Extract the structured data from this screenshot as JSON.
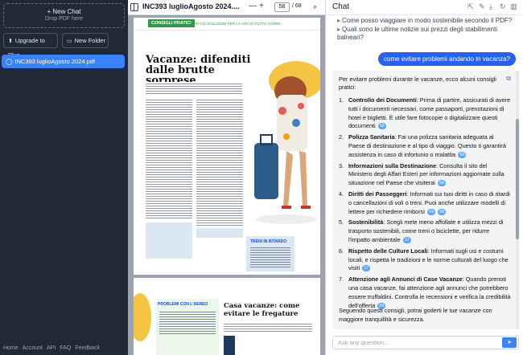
{
  "sidebar": {
    "new_chat": "+ New Chat",
    "drop_hint": "Drop PDF here",
    "upgrade": "Upgrade to Plus",
    "new_folder": "New Folder",
    "file": "INC393 luglioAgosto 2024.pdf",
    "footer": [
      "Home",
      "Account",
      "API",
      "FAQ",
      "Feedback"
    ]
  },
  "pdf": {
    "title": "INC393 luglioAgosto 2024....",
    "zoom_out": "—",
    "zoom_in": "+",
    "page": "58",
    "total": "/ 68",
    "badge": "CONSIGLI PRATICI",
    "subtitle": "DIRITTI E SOLUZIONI PER LA VITA DI TUTTI I GIORNI",
    "headline": "Vacanze: difenditi dalle brutte sorprese",
    "box_title": "TRENI IN RITARDO",
    "p2_left": "PROBLEMI CON L'AEREO",
    "p2_headline": "Casa vacanze: come evitare le fregature"
  },
  "chat": {
    "title": "Chat",
    "suggestions": [
      "Come posso viaggiare in modo sostenibile secondo il PDF?",
      "Quali sono le ultime notizie sui prezzi degli stabilimenti balneari?"
    ],
    "user_question": "come evitare problemi andando in vacanza?",
    "intro": "Per evitare problemi durante le vacanze, ecco alcuni consigli pratici:",
    "items": [
      {
        "n": "1.",
        "b": "Controllo dei Documenti",
        "t": ": Prima di partire, assicurati di avere tutti i documenti necessari, come passaporti, prenotazioni di hotel e biglietti. È utile fare fotocopie o digitalizzare questi documenti",
        "c": [
          "58"
        ]
      },
      {
        "n": "2.",
        "b": "Polizza Sanitaria",
        "t": ": Fai una polizza sanitaria adeguata al Paese di destinazione e al tipo di viaggio. Questo ti garantirà assistenza in caso di infortunio o malattia",
        "c": [
          "58"
        ]
      },
      {
        "n": "3.",
        "b": "Informazioni sulla Destinazione",
        "t": ": Consulta il sito del Ministero degli Affari Esteri per informazioni aggiornate sulla situazione nel Paese che visiterai",
        "c": [
          "58"
        ]
      },
      {
        "n": "4.",
        "b": "Diritti dei Passeggeri",
        "t": ": Informati sui tuoi diritti in caso di ritardi o cancellazioni di voli o treni. Puoi anche utilizzare modelli di lettere per richiedere rimborsi",
        "c": [
          "59",
          "58"
        ]
      },
      {
        "n": "5.",
        "b": "Sostenibilità",
        "t": ": Scegli mete meno affollate e utilizza mezzi di trasporto sostenibili, come treni o biciclette, per ridurre l'impatto ambientale",
        "c": [
          "17"
        ]
      },
      {
        "n": "6.",
        "b": "Rispetto delle Culture Locali",
        "t": ": Informati sugli usi e costumi locali, e rispetta le tradizioni e le norme culturali del luogo che visiti",
        "c": [
          "17"
        ]
      },
      {
        "n": "7.",
        "b": "Attenzione agli Annunci di Case Vacanze",
        "t": ": Quando prenoti una casa vacanze, fai attenzione agli annunci che potrebbero essere truffaldini. Controlla le recensioni e verifica la credibilità dell'offerta",
        "c": [
          "59"
        ]
      }
    ],
    "conclusion": "Seguendo questi consigli, potrai goderti le tue vacanze con maggiore tranquillità e sicurezza.",
    "input_placeholder": "Ask any question...",
    "send_icon": "paper-plane"
  }
}
